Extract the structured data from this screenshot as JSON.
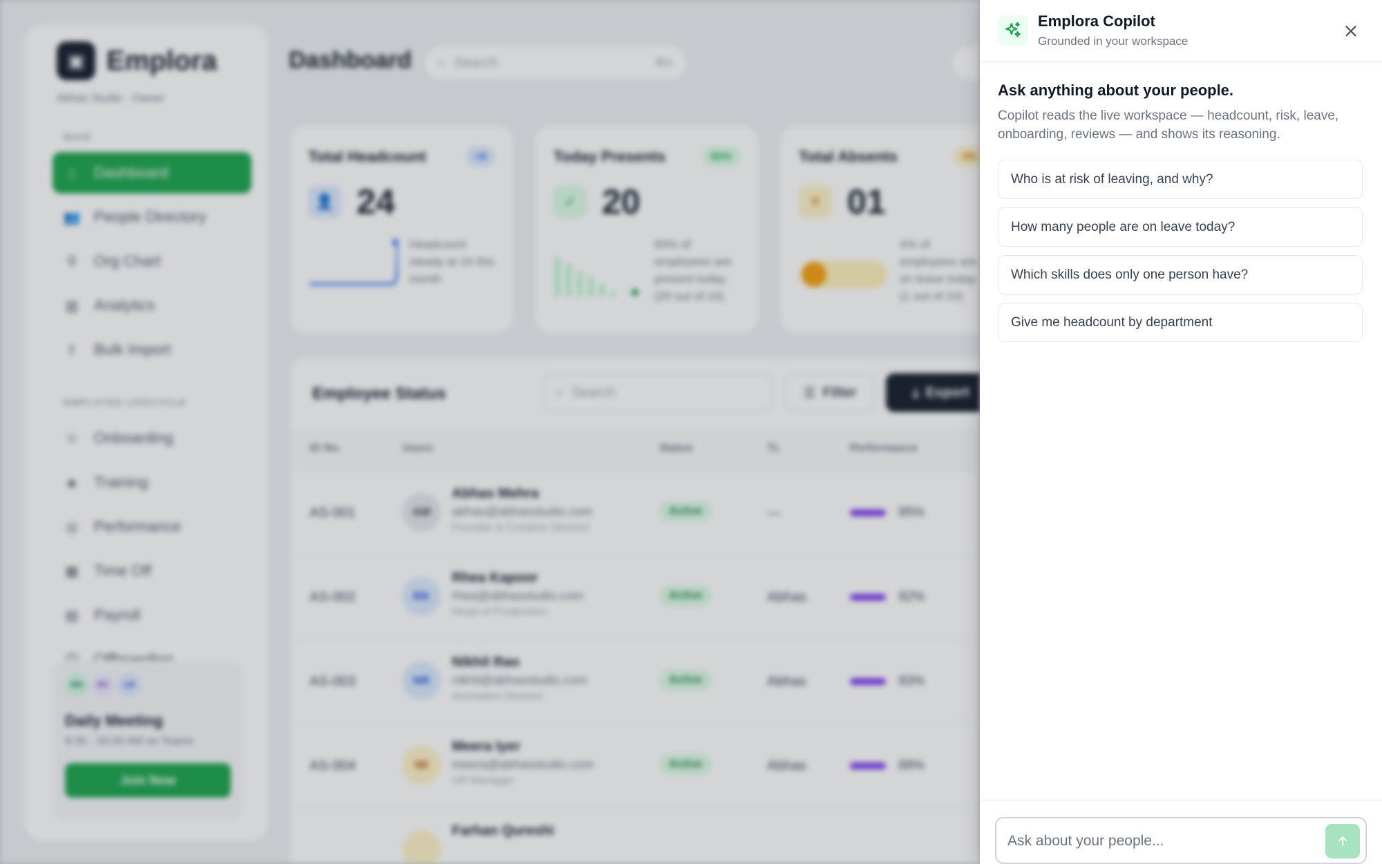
{
  "app": {
    "brand": "Emplora",
    "workspace": "Abhas Studio · Owner",
    "page_title": "Dashboard",
    "search_placeholder": "Search",
    "search_shortcut": "⌘K"
  },
  "sidebar": {
    "section_main": "MAIN",
    "main_items": [
      {
        "label": "Dashboard",
        "icon": "home-icon"
      },
      {
        "label": "People Directory",
        "icon": "users-icon"
      },
      {
        "label": "Org Chart",
        "icon": "org-chart-icon"
      },
      {
        "label": "Analytics",
        "icon": "analytics-icon"
      },
      {
        "label": "Bulk Import",
        "icon": "upload-icon"
      }
    ],
    "section_lifecycle": "EMPLOYEE LIFECYCLE",
    "lifecycle_items": [
      {
        "label": "Onboarding",
        "icon": "user-add-icon"
      },
      {
        "label": "Training",
        "icon": "graduation-icon"
      },
      {
        "label": "Performance",
        "icon": "target-icon"
      },
      {
        "label": "Time Off",
        "icon": "calendar-icon"
      },
      {
        "label": "Payroll",
        "icon": "wallet-icon"
      },
      {
        "label": "Offboarding",
        "icon": "user-remove-icon"
      }
    ],
    "meeting": {
      "avatars": [
        "MH",
        "RC",
        "LW"
      ],
      "title": "Daily Meeting",
      "time": "9:30 - 10:30 AM on Teams",
      "button": "Join Now"
    }
  },
  "stats": [
    {
      "title": "Total Headcount",
      "badge": "+6",
      "value": "24",
      "note": "Headcount steady at 24 this month",
      "color": "#2563eb"
    },
    {
      "title": "Today Presents",
      "badge": "83%",
      "value": "20",
      "note": "83% of employees are present today (20 out of 24)",
      "color": "#16a34a"
    },
    {
      "title": "Total Absents",
      "badge": "4%",
      "value": "01",
      "note": "4% of employees are on leave today (1 out of 24)",
      "color": "#d97706"
    }
  ],
  "table": {
    "title": "Employee Status",
    "search_placeholder": "Search",
    "filter_label": "Filter",
    "export_label": "Export",
    "columns": [
      "ID No.",
      "Users",
      "Status",
      "TL",
      "Performance"
    ],
    "rows": [
      {
        "id": "AS-001",
        "initials": "AM",
        "name": "Abhas Mehra",
        "email": "abhas@abhasstudio.com",
        "role": "Founder & Creative Director",
        "status": "Active",
        "tl": "—",
        "performance": "95%"
      },
      {
        "id": "AS-002",
        "initials": "RK",
        "name": "Rhea Kapoor",
        "email": "rhea@abhasstudio.com",
        "role": "Head of Production",
        "status": "Active",
        "tl": "Abhas",
        "performance": "92%"
      },
      {
        "id": "AS-003",
        "initials": "NR",
        "name": "Nikhil Rao",
        "email": "nikhil@abhasstudio.com",
        "role": "Animation Director",
        "status": "Active",
        "tl": "Abhas",
        "performance": "93%"
      },
      {
        "id": "AS-004",
        "initials": "MI",
        "name": "Meera Iyer",
        "email": "meera@abhasstudio.com",
        "role": "VR Manager",
        "status": "Active",
        "tl": "Abhas",
        "performance": "88%"
      },
      {
        "id": "AS-005",
        "initials": "FQ",
        "name": "Farhan Qureshi",
        "email": "",
        "role": "",
        "status": "",
        "tl": "",
        "performance": ""
      }
    ]
  },
  "copilot": {
    "title": "Emplora Copilot",
    "subtitle": "Grounded in your workspace",
    "heading": "Ask anything about your people.",
    "description": "Copilot reads the live workspace — headcount, risk, leave, onboarding, reviews — and shows its reasoning.",
    "suggestions": [
      "Who is at risk of leaving, and why?",
      "How many people are on leave today?",
      "Which skills does only one person have?",
      "Give me headcount by department"
    ],
    "input_placeholder": "Ask about your people...",
    "accent": "#16a34a"
  }
}
